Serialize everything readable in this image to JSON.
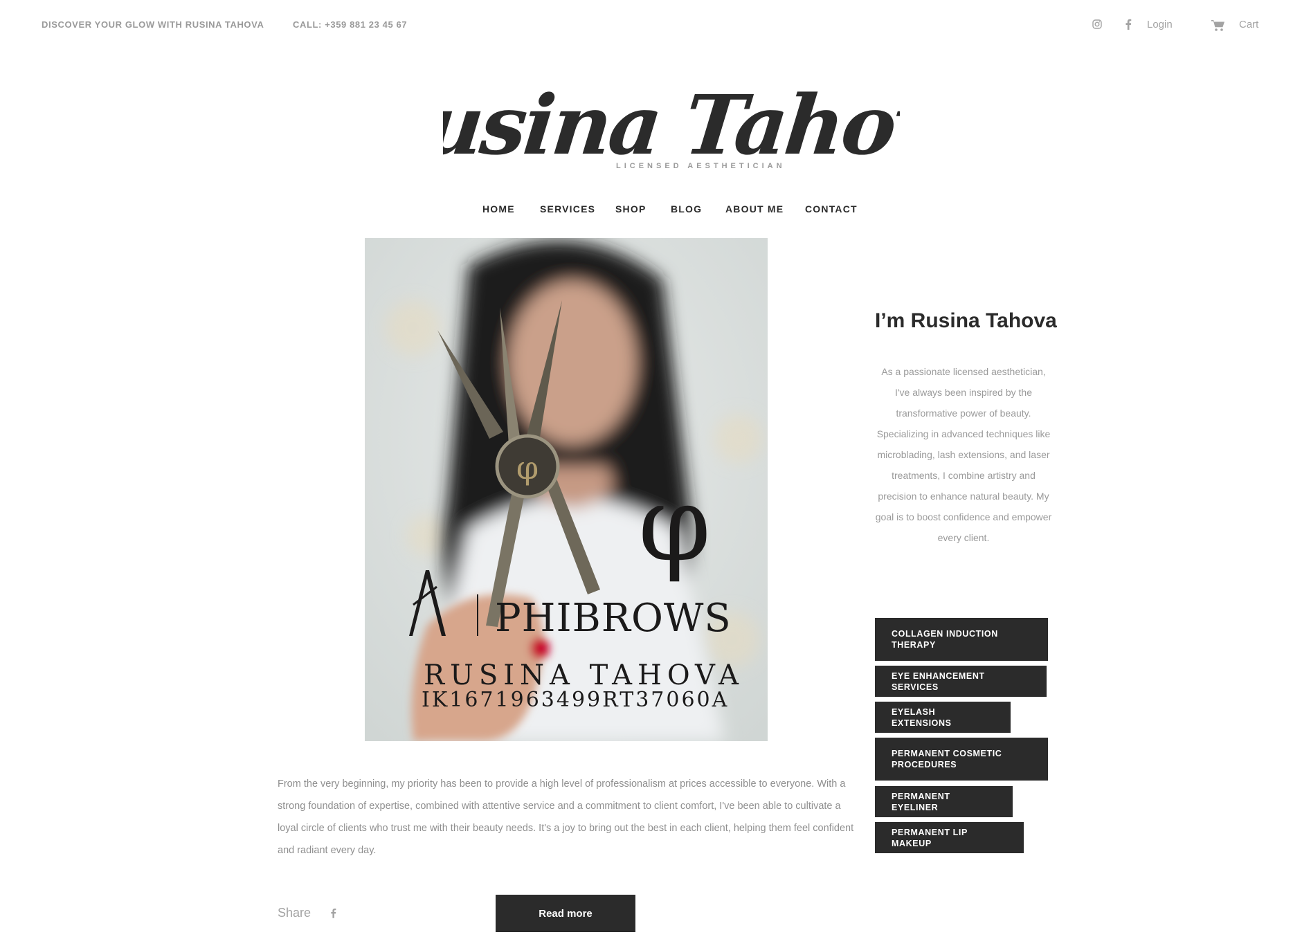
{
  "topbar": {
    "tagline": "DISCOVER YOUR GLOW WITH RUSINA TAHOVA",
    "phone": "CALL: +359 881 23 45 67",
    "login_label": "Login",
    "cart_label": "Cart"
  },
  "logo": {
    "name": "Rusina Tahova",
    "subtitle": "LICENSED AESTHETICIAN"
  },
  "nav": {
    "items": [
      {
        "label": "HOME"
      },
      {
        "label": "SERVICES"
      },
      {
        "label": "SHOP"
      },
      {
        "label": "BLOG"
      },
      {
        "label": "ABOUT ME"
      },
      {
        "label": "CONTACT"
      }
    ]
  },
  "hero": {
    "brand_text": "PHIBROWS",
    "certificate_name": "RUSINA TAHOVA",
    "certificate_code": "IK1671963499RT37060A"
  },
  "article": {
    "body": "From the very beginning, my priority has been to provide a high level of professionalism at prices accessible to everyone. With a strong foundation of expertise, combined with attentive service and a commitment to client comfort, I've been able to cultivate a loyal circle of clients who trust me with their beauty needs. It's a joy to bring out the best in each client, helping them feel confident and radiant every day.",
    "share_label": "Share",
    "read_more_label": "Read more"
  },
  "sidebar": {
    "title": "I’m Rusina Tahova",
    "bio": "As a passionate licensed aesthetician, I've always been inspired by the transformative power of beauty. Specializing in advanced techniques like microblading, lash extensions, and laser treatments, I combine artistry and precision to enhance natural beauty. My goal is to boost confidence and empower every client.",
    "tags": [
      {
        "label": "COLLAGEN INDUCTION THERAPY"
      },
      {
        "label": "EYE ENHANCEMENT SERVICES"
      },
      {
        "label": "EYELASH EXTENSIONS"
      },
      {
        "label": "PERMANENT COSMETIC PROCEDURES"
      },
      {
        "label": "PERMANENT EYELINER"
      },
      {
        "label": "PERMANENT LIP MAKEUP"
      }
    ]
  },
  "colors": {
    "primary_dark": "#2b2b2b",
    "muted_text": "#9a9a9a",
    "accent_red": "#c8102e"
  }
}
